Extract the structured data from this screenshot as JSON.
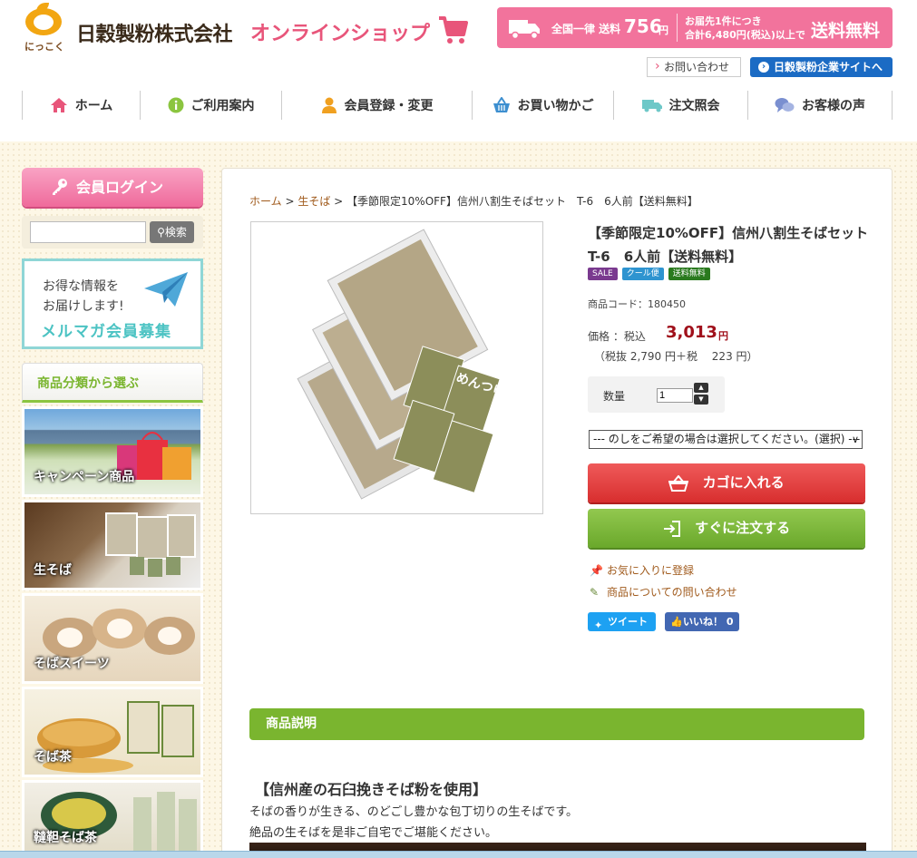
{
  "header": {
    "logo_sub": "にっこく",
    "brand": "日穀製粉株式会社",
    "shop_name": "オンラインショップ",
    "shipping": {
      "label": "全国一律 送料",
      "amount": "756",
      "yen": "円",
      "cond1": "お届先1件につき",
      "cond2": "合計6,480円(税込)以上で",
      "free": "送料無料"
    },
    "inquiry_label": "お問い合わせ",
    "corp_label": "日穀製粉企業サイトへ",
    "nav": [
      {
        "label": "ホーム",
        "icon": "home-icon"
      },
      {
        "label": "ご利用案内",
        "icon": "info-icon"
      },
      {
        "label": "会員登録・変更",
        "icon": "user-icon"
      },
      {
        "label": "お買い物かご",
        "icon": "basket-icon"
      },
      {
        "label": "注文照会",
        "icon": "truck-icon"
      },
      {
        "label": "お客様の声",
        "icon": "chat-icon"
      }
    ]
  },
  "sidebar": {
    "login_label": "会員ログイン",
    "search_button": "検索",
    "search_value": "",
    "mailmag": {
      "line1": "お得な情報を",
      "line2": "お届けします!",
      "line3": "メルマガ会員募集"
    },
    "category_heading": "商品分類から選ぶ",
    "categories": [
      "キャンペーン商品",
      "生そば",
      "そばスイーツ",
      "そば茶",
      "韃靼そば茶"
    ]
  },
  "product": {
    "breadcrumb": {
      "home": "ホーム",
      "sep": " > ",
      "category": "生そば",
      "current": "【季節限定10%OFF】信州八割生そばセット　T-6　6人前【送料無料】"
    },
    "title": "【季節限定10%OFF】信州八割生そばセット　T-6　6人前【送料無料】",
    "badges": [
      "SALE",
      "クール便",
      "送料無料"
    ],
    "code_label": "商品コード：",
    "code": "180450",
    "price_label": "価格 ：税込",
    "price": "3,013",
    "price_yen": "円",
    "tax_line": "（税抜  2,790  円＋税　  223 円）",
    "qty_label": "数量",
    "qty_value": "1",
    "noshi_option": "--- のしをご希望の場合は選択してください。(選択) ---",
    "cart_button": "カゴに入れる",
    "order_button": "すぐに注文する",
    "favorite_link": "お気に入りに登録",
    "inquiry_link": "商品についての問い合わせ",
    "tweet_label": "ツイート",
    "like_label": "いいね！ 0",
    "package_text": "めんつゆ"
  },
  "description": {
    "heading": "商品説明",
    "title": "【信州産の石臼挽きそば粉を使用】",
    "line1": "そばの香りが生きる、のどごし豊かな包丁切りの生そばです。",
    "line2": "絶品の生そばを是非ご自宅でご堪能ください。"
  },
  "colors": {
    "accent_pink": "#f2739c",
    "green": "#7ab52f",
    "price_red": "#a0101b",
    "link_brown": "#a05a1c"
  }
}
